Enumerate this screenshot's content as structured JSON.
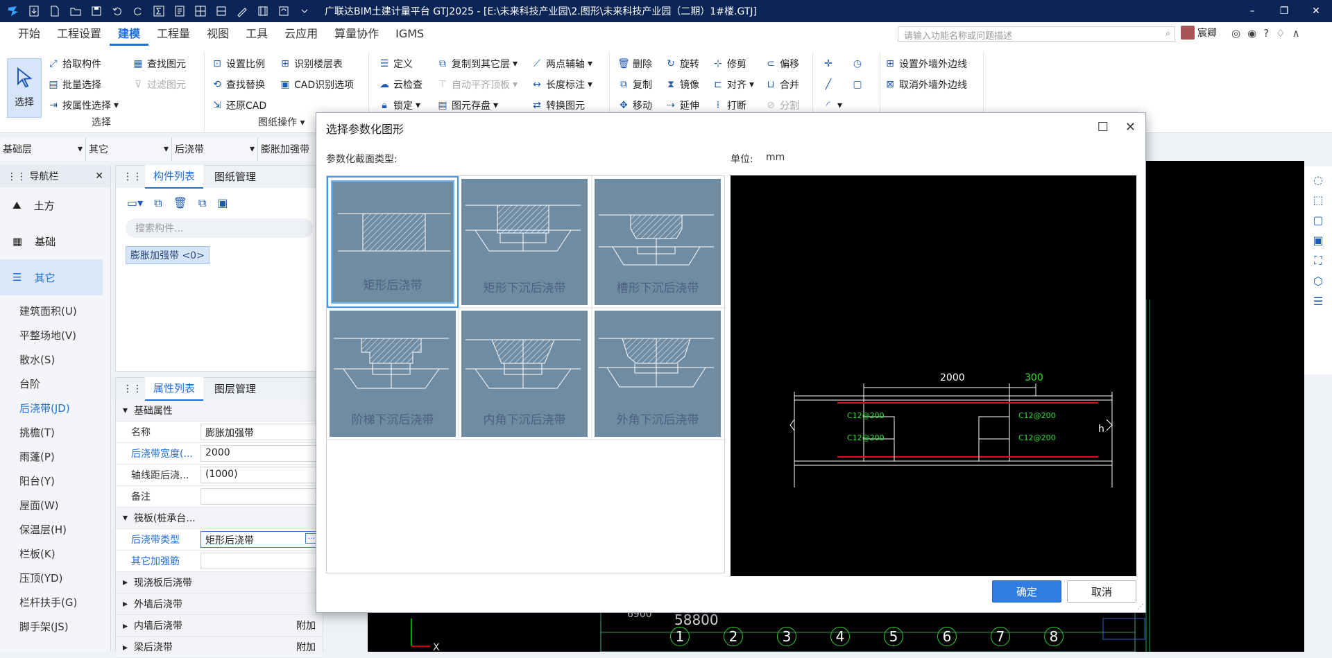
{
  "window": {
    "title": "广联达BIM土建计量平台 GTJ2025 - [E:\\未来科技产业园\\2.图形\\未来科技产业园（二期）1#楼.GTJ]",
    "min": "–",
    "max": "❐",
    "close": "✕"
  },
  "menu": [
    "开始",
    "工程设置",
    "建模",
    "工程量",
    "视图",
    "工具",
    "云应用",
    "算量协作",
    "IGMS"
  ],
  "search_placeholder": "请输入功能名称或问题描述",
  "user": "宸卿",
  "topicons": [
    "◎",
    "◉",
    "?",
    "♢",
    "∧"
  ],
  "ribbon": {
    "select": "选择",
    "select_group": "选择",
    "pick": "拾取构件",
    "batch": "批量选择",
    "byprop": "按属性选择",
    "find": "查找图元",
    "filter": "过滤图元",
    "scale": "设置比例",
    "findreplace": "查找替换",
    "restore": "还原CAD",
    "identify_floor": "识别楼层表",
    "cad_options": "CAD识别选项",
    "drawing_ops": "图纸操作",
    "define": "定义",
    "cloud_check": "云检查",
    "lock": "锁定",
    "copy_to_floor": "复制到其它层",
    "auto_top": "自动平齐顶板",
    "element_save": "图元存盘",
    "two_point": "两点辅轴",
    "length_dim": "长度标注",
    "convert": "转换图元",
    "delete": "删除",
    "copy": "复制",
    "move": "移动",
    "rotate": "旋转",
    "mirror": "镜像",
    "extend": "延伸",
    "trim": "修剪",
    "align": "对齐",
    "break": "打断",
    "offset": "偏移",
    "merge": "合并",
    "split": "分割",
    "set_outer": "设置外墙外边线",
    "cancel_outer": "取消外墙外边线"
  },
  "dropdowns": [
    "基础层",
    "其它",
    "后浇带",
    "膨胀加强带"
  ],
  "nav": {
    "title": "导航栏",
    "cats": [
      "土方",
      "基础",
      "其它"
    ],
    "items": [
      "建筑面积(U)",
      "平整场地(V)",
      "散水(S)",
      "台阶",
      "后浇带(JD)",
      "挑檐(T)",
      "雨蓬(P)",
      "阳台(Y)",
      "屋面(W)",
      "保温层(H)",
      "栏板(K)",
      "压顶(YD)",
      "栏杆扶手(G)",
      "脚手架(JS)"
    ]
  },
  "comp": {
    "tab1": "构件列表",
    "tab2": "图纸管理",
    "search": "搜索构件...",
    "tag": "膨胀加强带 <0>"
  },
  "props": {
    "tab1": "属性列表",
    "tab2": "图层管理",
    "sec1": "基础属性",
    "rows": [
      {
        "k": "名称",
        "v": "膨胀加强带"
      },
      {
        "k": "后浇带宽度(...",
        "v": "2000"
      },
      {
        "k": "轴线距后浇...",
        "v": "(1000)"
      },
      {
        "k": "备注",
        "v": ""
      }
    ],
    "sec2": "筏板(桩承台...",
    "rows2": [
      {
        "k": "后浇带类型",
        "v": "矩形后浇带"
      },
      {
        "k": "其它加强筋",
        "v": ""
      }
    ],
    "secs": [
      "现浇板后浇带",
      "外墙后浇带",
      "内墙后浇带",
      "梁后浇带"
    ],
    "extra": "附加"
  },
  "canvas": {
    "axis_nums": [
      "1",
      "2",
      "3",
      "4",
      "5",
      "6",
      "7",
      "8"
    ],
    "dim": "58800",
    "dimrow": "6900"
  },
  "dialog": {
    "title": "选择参数化图形",
    "type_label": "参数化截面类型:",
    "unit_label": "单位:",
    "unit": "mm",
    "shapes": [
      "矩形后浇带",
      "矩形下沉后浇带",
      "槽形下沉后浇带",
      "阶梯下沉后浇带",
      "内角下沉后浇带",
      "外角下沉后浇带"
    ],
    "preview": {
      "width": "2000",
      "extra": "300",
      "rebar": "C12@200",
      "h": "h"
    },
    "ok": "确定",
    "cancel": "取消"
  }
}
